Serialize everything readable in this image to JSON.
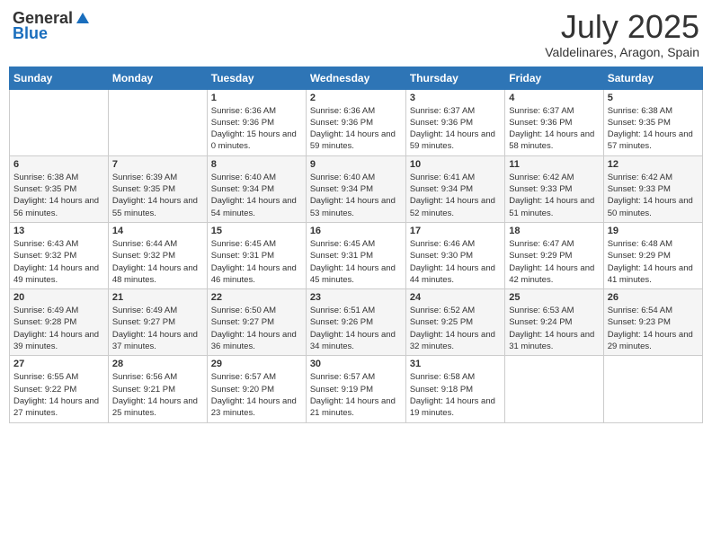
{
  "header": {
    "logo_general": "General",
    "logo_blue": "Blue",
    "month": "July 2025",
    "location": "Valdelinares, Aragon, Spain"
  },
  "days_of_week": [
    "Sunday",
    "Monday",
    "Tuesday",
    "Wednesday",
    "Thursday",
    "Friday",
    "Saturday"
  ],
  "weeks": [
    [
      {
        "day": "",
        "info": ""
      },
      {
        "day": "",
        "info": ""
      },
      {
        "day": "1",
        "info": "Sunrise: 6:36 AM\nSunset: 9:36 PM\nDaylight: 15 hours and 0 minutes."
      },
      {
        "day": "2",
        "info": "Sunrise: 6:36 AM\nSunset: 9:36 PM\nDaylight: 14 hours and 59 minutes."
      },
      {
        "day": "3",
        "info": "Sunrise: 6:37 AM\nSunset: 9:36 PM\nDaylight: 14 hours and 59 minutes."
      },
      {
        "day": "4",
        "info": "Sunrise: 6:37 AM\nSunset: 9:36 PM\nDaylight: 14 hours and 58 minutes."
      },
      {
        "day": "5",
        "info": "Sunrise: 6:38 AM\nSunset: 9:35 PM\nDaylight: 14 hours and 57 minutes."
      }
    ],
    [
      {
        "day": "6",
        "info": "Sunrise: 6:38 AM\nSunset: 9:35 PM\nDaylight: 14 hours and 56 minutes."
      },
      {
        "day": "7",
        "info": "Sunrise: 6:39 AM\nSunset: 9:35 PM\nDaylight: 14 hours and 55 minutes."
      },
      {
        "day": "8",
        "info": "Sunrise: 6:40 AM\nSunset: 9:34 PM\nDaylight: 14 hours and 54 minutes."
      },
      {
        "day": "9",
        "info": "Sunrise: 6:40 AM\nSunset: 9:34 PM\nDaylight: 14 hours and 53 minutes."
      },
      {
        "day": "10",
        "info": "Sunrise: 6:41 AM\nSunset: 9:34 PM\nDaylight: 14 hours and 52 minutes."
      },
      {
        "day": "11",
        "info": "Sunrise: 6:42 AM\nSunset: 9:33 PM\nDaylight: 14 hours and 51 minutes."
      },
      {
        "day": "12",
        "info": "Sunrise: 6:42 AM\nSunset: 9:33 PM\nDaylight: 14 hours and 50 minutes."
      }
    ],
    [
      {
        "day": "13",
        "info": "Sunrise: 6:43 AM\nSunset: 9:32 PM\nDaylight: 14 hours and 49 minutes."
      },
      {
        "day": "14",
        "info": "Sunrise: 6:44 AM\nSunset: 9:32 PM\nDaylight: 14 hours and 48 minutes."
      },
      {
        "day": "15",
        "info": "Sunrise: 6:45 AM\nSunset: 9:31 PM\nDaylight: 14 hours and 46 minutes."
      },
      {
        "day": "16",
        "info": "Sunrise: 6:45 AM\nSunset: 9:31 PM\nDaylight: 14 hours and 45 minutes."
      },
      {
        "day": "17",
        "info": "Sunrise: 6:46 AM\nSunset: 9:30 PM\nDaylight: 14 hours and 44 minutes."
      },
      {
        "day": "18",
        "info": "Sunrise: 6:47 AM\nSunset: 9:29 PM\nDaylight: 14 hours and 42 minutes."
      },
      {
        "day": "19",
        "info": "Sunrise: 6:48 AM\nSunset: 9:29 PM\nDaylight: 14 hours and 41 minutes."
      }
    ],
    [
      {
        "day": "20",
        "info": "Sunrise: 6:49 AM\nSunset: 9:28 PM\nDaylight: 14 hours and 39 minutes."
      },
      {
        "day": "21",
        "info": "Sunrise: 6:49 AM\nSunset: 9:27 PM\nDaylight: 14 hours and 37 minutes."
      },
      {
        "day": "22",
        "info": "Sunrise: 6:50 AM\nSunset: 9:27 PM\nDaylight: 14 hours and 36 minutes."
      },
      {
        "day": "23",
        "info": "Sunrise: 6:51 AM\nSunset: 9:26 PM\nDaylight: 14 hours and 34 minutes."
      },
      {
        "day": "24",
        "info": "Sunrise: 6:52 AM\nSunset: 9:25 PM\nDaylight: 14 hours and 32 minutes."
      },
      {
        "day": "25",
        "info": "Sunrise: 6:53 AM\nSunset: 9:24 PM\nDaylight: 14 hours and 31 minutes."
      },
      {
        "day": "26",
        "info": "Sunrise: 6:54 AM\nSunset: 9:23 PM\nDaylight: 14 hours and 29 minutes."
      }
    ],
    [
      {
        "day": "27",
        "info": "Sunrise: 6:55 AM\nSunset: 9:22 PM\nDaylight: 14 hours and 27 minutes."
      },
      {
        "day": "28",
        "info": "Sunrise: 6:56 AM\nSunset: 9:21 PM\nDaylight: 14 hours and 25 minutes."
      },
      {
        "day": "29",
        "info": "Sunrise: 6:57 AM\nSunset: 9:20 PM\nDaylight: 14 hours and 23 minutes."
      },
      {
        "day": "30",
        "info": "Sunrise: 6:57 AM\nSunset: 9:19 PM\nDaylight: 14 hours and 21 minutes."
      },
      {
        "day": "31",
        "info": "Sunrise: 6:58 AM\nSunset: 9:18 PM\nDaylight: 14 hours and 19 minutes."
      },
      {
        "day": "",
        "info": ""
      },
      {
        "day": "",
        "info": ""
      }
    ]
  ]
}
